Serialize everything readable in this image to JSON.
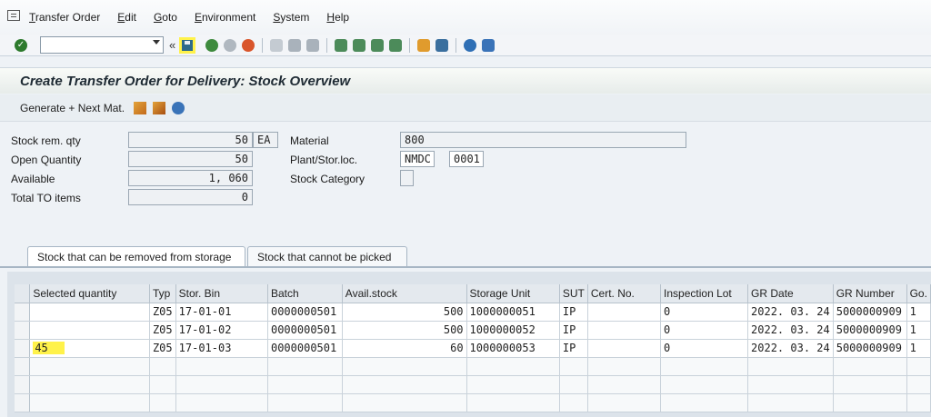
{
  "menu": {
    "items": [
      "Transfer Order",
      "Edit",
      "Goto",
      "Environment",
      "System",
      "Help"
    ]
  },
  "toolbar": {
    "command_field": "",
    "icons": [
      "enter-icon",
      "save-icon",
      "back-icon",
      "exit-icon",
      "cancel-icon",
      "print-icon",
      "find-icon",
      "find-next-icon",
      "first-page-icon",
      "prev-page-icon",
      "next-page-icon",
      "last-page-icon",
      "create-session-icon",
      "shortcut-icon",
      "help-icon",
      "customize-layout-icon"
    ],
    "highlight_color": "#fff24a"
  },
  "title": "Create Transfer Order for Delivery: Stock Overview",
  "appbar": {
    "generate_label": "Generate + Next Mat."
  },
  "form": {
    "stock_rem_qty": {
      "label": "Stock rem. qty",
      "value": "50",
      "unit": "EA"
    },
    "open_quantity": {
      "label": "Open Quantity",
      "value": "50"
    },
    "available": {
      "label": "Available",
      "value": "1, 060"
    },
    "total_to_items": {
      "label": "Total TO items",
      "value": "0"
    },
    "material": {
      "label": "Material",
      "value": "800"
    },
    "plant_stor_loc": {
      "label": "Plant/Stor.loc.",
      "plant": "NMDC",
      "storage_location": "0001"
    },
    "stock_category": {
      "label": "Stock Category",
      "value": ""
    }
  },
  "tabs": [
    {
      "label": "Stock that can be removed from storage",
      "active": true
    },
    {
      "label": "Stock that cannot be picked",
      "active": false
    }
  ],
  "table": {
    "columns": [
      "Selected quantity",
      "Typ",
      "Stor. Bin",
      "Batch",
      "Avail.stock",
      "Storage Unit",
      "SUT",
      "Cert. No.",
      "Inspection Lot",
      "GR Date",
      "GR Number",
      "Go."
    ],
    "rows": [
      [
        "",
        "Z05",
        "17-01-01",
        "0000000501",
        "500",
        "1000000051",
        "IP",
        "",
        "0",
        "2022. 03. 24",
        "5000000909",
        "1"
      ],
      [
        "",
        "Z05",
        "17-01-02",
        "0000000501",
        "500",
        "1000000052",
        "IP",
        "",
        "0",
        "2022. 03. 24",
        "5000000909",
        "1"
      ],
      [
        "45",
        "Z05",
        "17-01-03",
        "0000000501",
        "60",
        "1000000053",
        "IP",
        "",
        "0",
        "2022. 03. 24",
        "5000000909",
        "1"
      ]
    ]
  }
}
